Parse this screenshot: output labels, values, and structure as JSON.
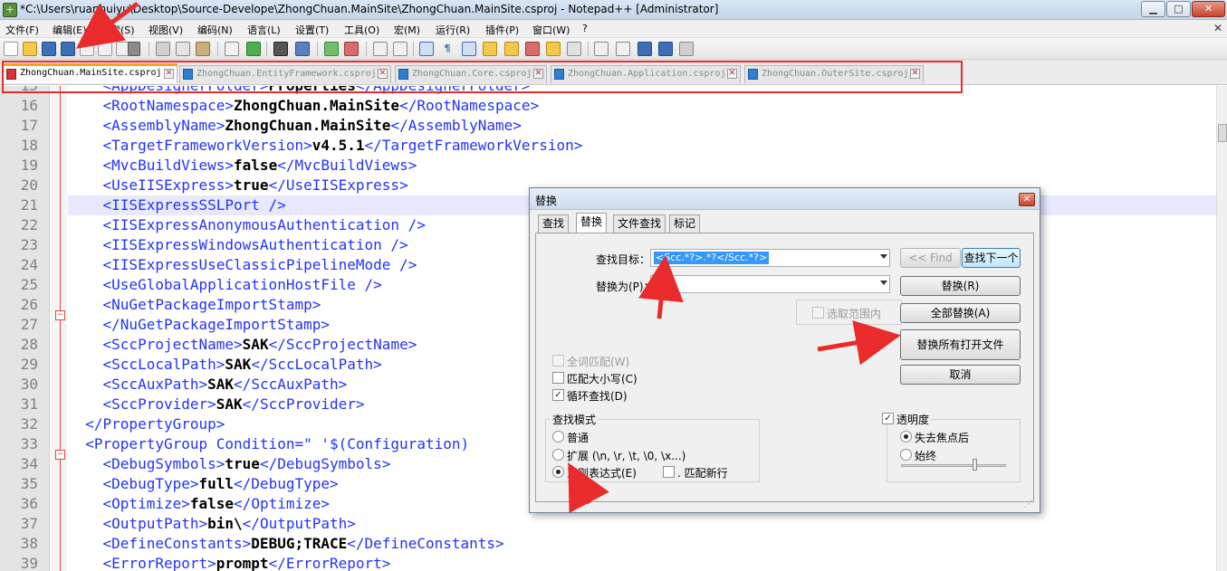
{
  "window": {
    "title": "*C:\\Users\\ruanhuiyu\\Desktop\\Source-Develope\\ZhongChuan.MainSite\\ZhongChuan.MainSite.csproj - Notepad++ [Administrator]",
    "app_icon_glyph": "+",
    "minimize_glyph": "▁",
    "maximize_glyph": "□",
    "close_glyph": "✕"
  },
  "menu": {
    "items": [
      "文件(F)",
      "编辑(E)",
      "搜索(S)",
      "视图(V)",
      "编码(N)",
      "语言(L)",
      "设置(T)",
      "工具(O)",
      "宏(M)",
      "运行(R)",
      "插件(P)",
      "窗口(W)",
      "?"
    ],
    "close_glyph": "✕"
  },
  "tabs": [
    {
      "label": "ZhongChuan.MainSite.csproj",
      "active": true
    },
    {
      "label": "ZhongChuan.EntityFramework.csproj",
      "active": false
    },
    {
      "label": "ZhongChuan.Core.csproj",
      "active": false
    },
    {
      "label": "ZhongChuan.Application.csproj",
      "active": false
    },
    {
      "label": "ZhongChuan.OuterSite.csproj",
      "active": false
    }
  ],
  "editor": {
    "lines": [
      {
        "num": "15",
        "code": "    <AppDesignerFolder>Properties</AppDesignerFolder>"
      },
      {
        "num": "16",
        "code": "    <RootNamespace>ZhongChuan.MainSite</RootNamespace>"
      },
      {
        "num": "17",
        "code": "    <AssemblyName>ZhongChuan.MainSite</AssemblyName>"
      },
      {
        "num": "18",
        "code": "    <TargetFrameworkVersion>v4.5.1</TargetFrameworkVersion>"
      },
      {
        "num": "19",
        "code": "    <MvcBuildViews>false</MvcBuildViews>"
      },
      {
        "num": "20",
        "code": "    <UseIISExpress>true</UseIISExpress>"
      },
      {
        "num": "21",
        "code": "    <IISExpressSSLPort />",
        "current": true
      },
      {
        "num": "22",
        "code": "    <IISExpressAnonymousAuthentication />"
      },
      {
        "num": "23",
        "code": "    <IISExpressWindowsAuthentication />"
      },
      {
        "num": "24",
        "code": "    <IISExpressUseClassicPipelineMode />"
      },
      {
        "num": "25",
        "code": "    <UseGlobalApplicationHostFile />"
      },
      {
        "num": "26",
        "code": "    <NuGetPackageImportStamp>"
      },
      {
        "num": "27",
        "code": "    </NuGetPackageImportStamp>"
      },
      {
        "num": "28",
        "code": "    <SccProjectName>SAK</SccProjectName>"
      },
      {
        "num": "29",
        "code": "    <SccLocalPath>SAK</SccLocalPath>"
      },
      {
        "num": "30",
        "code": "    <SccAuxPath>SAK</SccAuxPath>"
      },
      {
        "num": "31",
        "code": "    <SccProvider>SAK</SccProvider>"
      },
      {
        "num": "32",
        "code": "  </PropertyGroup>"
      },
      {
        "num": "33",
        "code": "  <PropertyGroup Condition=\" '$(Configuration)"
      },
      {
        "num": "34",
        "code": "    <DebugSymbols>true</DebugSymbols>"
      },
      {
        "num": "35",
        "code": "    <DebugType>full</DebugType>"
      },
      {
        "num": "36",
        "code": "    <Optimize>false</Optimize>"
      },
      {
        "num": "37",
        "code": "    <OutputPath>bin\\</OutputPath>"
      },
      {
        "num": "38",
        "code": "    <DefineConstants>DEBUG;TRACE</DefineConstants>"
      },
      {
        "num": "39",
        "code": "    <ErrorReport>prompt</ErrorReport>"
      }
    ],
    "fold_minus_glyph": "−"
  },
  "dialog": {
    "title": "替换",
    "close_glyph": "✕",
    "tabs": [
      "查找",
      "替换",
      "文件查找",
      "标记"
    ],
    "active_tab": "替换",
    "find_label": "查找目标：",
    "find_value": "<Scc.*?>.*?</Scc.*?>",
    "replace_label": "替换为(P)：",
    "replace_value": "",
    "in_selection_label": "选取范围内",
    "buttons": {
      "find_prev": "<< Find",
      "find_next": "查找下一个",
      "replace": "替换(R)",
      "replace_all": "全部替换(A)",
      "replace_all_open": "替换所有打开文件",
      "cancel": "取消"
    },
    "options": {
      "whole_word": {
        "label": "全词匹配(W)",
        "checked": false,
        "enabled": false
      },
      "match_case": {
        "label": "匹配大小写(C)",
        "checked": false
      },
      "wrap_around": {
        "label": "循环查找(D)",
        "checked": true
      }
    },
    "search_mode": {
      "title": "查找模式",
      "normal": "普通",
      "extended": "扩展 (\\n, \\r, \\t, \\0, \\x...)",
      "regex": "正则表达式(E)",
      "dot_newline": ". 匹配新行",
      "selected": "regex"
    },
    "transparency": {
      "title": "透明度",
      "enabled": true,
      "on_lose_focus": "失去焦点后",
      "always": "始终",
      "selected": "on_lose_focus",
      "level": 0.75
    },
    "check_glyph": "✓",
    "grip_glyph": "⋰"
  },
  "colors": {
    "annotation_red": "#ea2b2b",
    "tag_blue": "#2233ff",
    "attr_red": "#e01010",
    "attr_value_purple": "#8000ff",
    "active_tab_accent": "#f7a224",
    "current_line": "#e8e8ff"
  }
}
